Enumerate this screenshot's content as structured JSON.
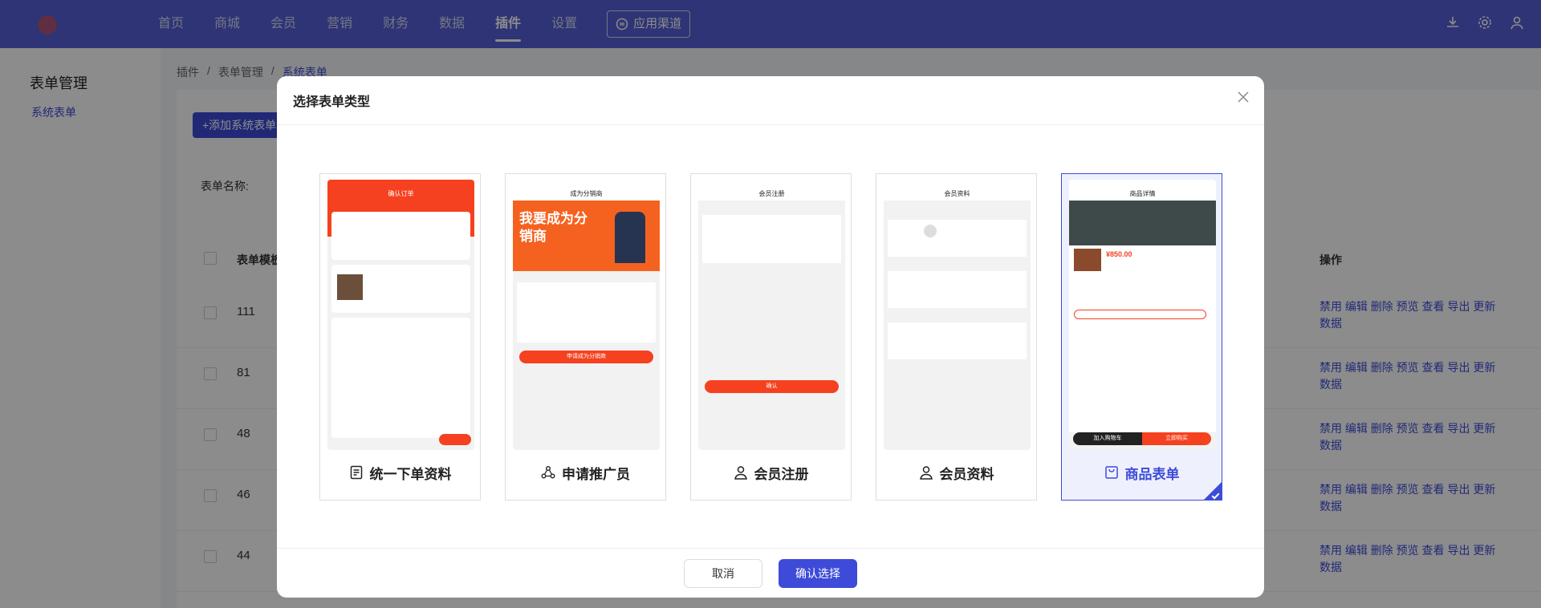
{
  "nav": {
    "items": [
      "首页",
      "商城",
      "会员",
      "营销",
      "财务",
      "数据",
      "插件",
      "设置"
    ],
    "active": "插件",
    "channel_label": "应用渠道"
  },
  "sidebar": {
    "title": "表单管理",
    "item": "系统表单"
  },
  "breadcrumb": [
    "插件",
    "/",
    "表单管理",
    "/",
    "系统表单"
  ],
  "toolbar": {
    "add_label": "+添加系统表单"
  },
  "filter": {
    "name_label": "表单名称:"
  },
  "table": {
    "col_name": "表单模板",
    "col_op": "操作",
    "rows": [
      {
        "id": "111"
      },
      {
        "id": "81"
      },
      {
        "id": "48"
      },
      {
        "id": "46"
      },
      {
        "id": "44"
      }
    ],
    "ops": "禁用 编辑 删除 预览 查看 导出 更新数据"
  },
  "modal": {
    "title": "选择表单类型",
    "cancel": "取消",
    "confirm": "确认选择",
    "cards": [
      {
        "label": "统一下单资料",
        "screen_title": "确认订单",
        "icon": "document-icon"
      },
      {
        "label": "申请推广员",
        "screen_title": "成为分销商",
        "icon": "share-icon",
        "banner": "我要成为分销商",
        "button": "申请成为分销商"
      },
      {
        "label": "会员注册",
        "screen_title": "会员注册",
        "icon": "user-icon",
        "button": "确认"
      },
      {
        "label": "会员资料",
        "screen_title": "会员资料",
        "icon": "user-icon"
      },
      {
        "label": "商品表单",
        "screen_title": "商品详情",
        "icon": "bag-icon",
        "price": "¥850.00",
        "cart": "加入购物车",
        "buy": "立即购买"
      }
    ],
    "selected_index": 4
  },
  "colors": {
    "primary": "#3d4bd8",
    "topbar": "#5560d6",
    "red": "#f5411f"
  }
}
